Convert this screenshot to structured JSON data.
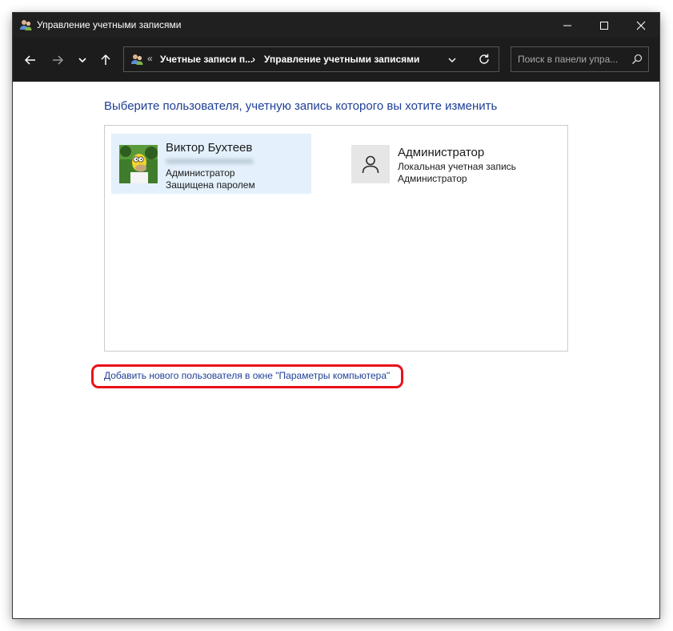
{
  "window": {
    "title": "Управление учетными записями",
    "icon": "user-accounts-icon"
  },
  "address_bar": {
    "overflow": "«",
    "crumbs": [
      "Учетные записи п...",
      "Управление учетными записями"
    ]
  },
  "search": {
    "placeholder": "Поиск в панели упра..."
  },
  "main": {
    "heading": "Выберите пользователя, учетную запись которого вы хотите изменить",
    "users": [
      {
        "name": "Виктор Бухтеев",
        "lines": [
          "Администратор",
          "Защищена паролем"
        ],
        "selected": true
      },
      {
        "name": "Администратор",
        "lines": [
          "Локальная учетная запись",
          "Администратор"
        ],
        "selected": false
      }
    ],
    "add_user_link": "Добавить нового пользователя в окне \"Параметры компьютера\""
  },
  "colors": {
    "titlebar": "#202020",
    "heading_blue": "#1e3f96",
    "selected_bg": "#e4f1fc",
    "highlight_red": "#e8121b"
  }
}
